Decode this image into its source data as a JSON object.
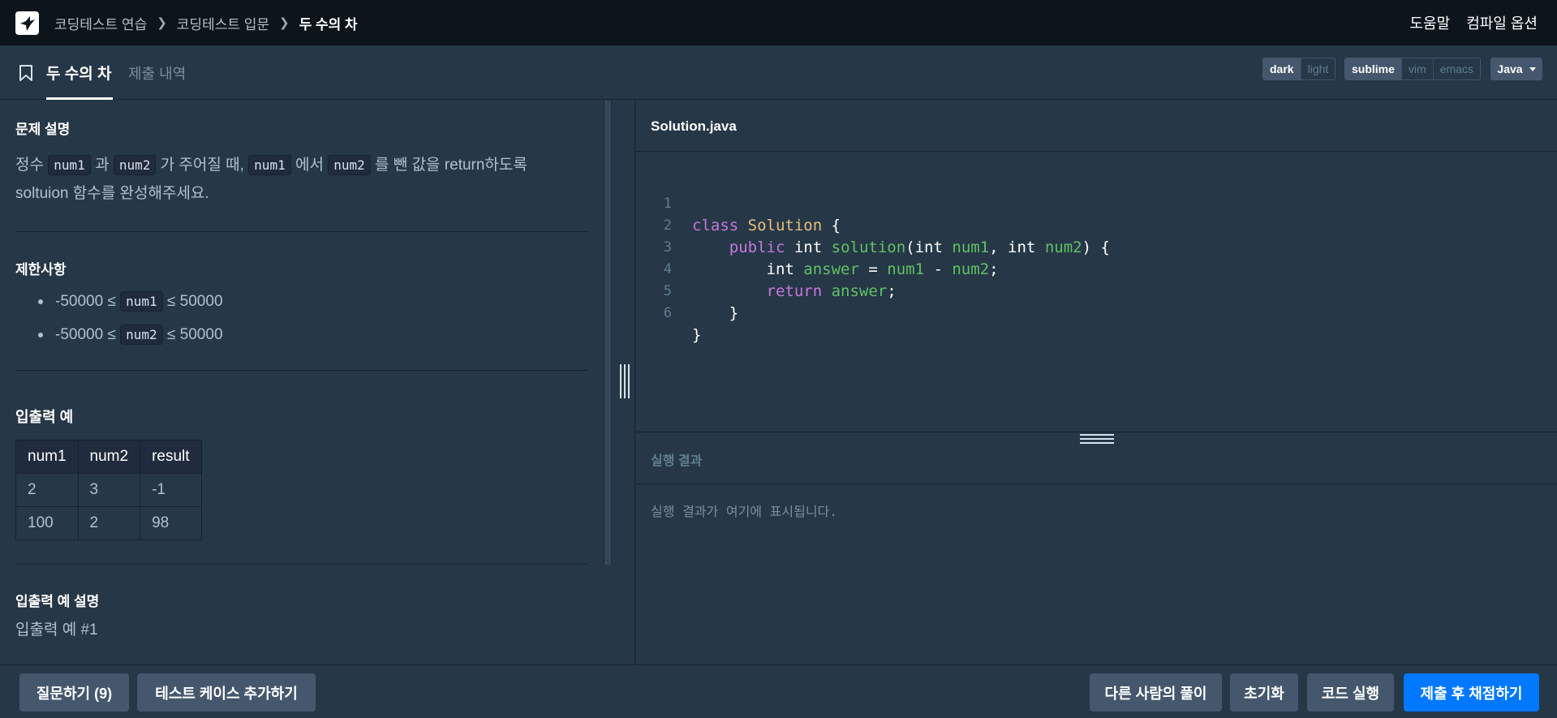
{
  "nav": {
    "breadcrumb": [
      "코딩테스트 연습",
      "코딩테스트 입문",
      "두 수의 차"
    ],
    "help": "도움말",
    "compile_options": "컴파일 옵션"
  },
  "tabs": {
    "active": "두 수의 차",
    "submissions": "제출 내역"
  },
  "toolbar": {
    "themes": [
      "dark",
      "light"
    ],
    "theme_selected": "dark",
    "keymaps": [
      "sublime",
      "vim",
      "emacs"
    ],
    "keymap_selected": "sublime",
    "language": "Java"
  },
  "problem": {
    "desc_title": "문제 설명",
    "desc": {
      "p1": "정수",
      "c1": "num1",
      "p2": "과",
      "c2": "num2",
      "p3": "가 주어질 때,",
      "c3": "num1",
      "p4": "에서",
      "c4": "num2",
      "p5": "를 뺀 값을 return하도록",
      "line2": "soltuion 함수를 완성해주세요."
    },
    "limits_title": "제한사항",
    "limits": [
      {
        "pre": "-50000 ≤",
        "code": "num1",
        "post": "≤ 50000"
      },
      {
        "pre": "-50000 ≤",
        "code": "num2",
        "post": "≤ 50000"
      }
    ],
    "io_title": "입출력 예",
    "io_table": {
      "headers": [
        "num1",
        "num2",
        "result"
      ],
      "rows": [
        [
          "2",
          "3",
          "-1"
        ],
        [
          "100",
          "2",
          "98"
        ]
      ]
    },
    "io_desc_title": "입출력 예 설명",
    "io_desc_item": "입출력 예 #1"
  },
  "editor": {
    "filename": "Solution.java",
    "line_numbers": [
      "1",
      "2",
      "3",
      "4",
      "5",
      "6"
    ],
    "tokens": {
      "class_kw": "class",
      "class_name": "Solution",
      "brace_open": " {",
      "public_kw": "public",
      "int_kw": "int",
      "method": "solution",
      "var_num1": "num1",
      "var_num2": "num2",
      "var_answer": "answer",
      "return_kw": "return"
    },
    "code_lines": [
      "class Solution {",
      "    public int solution(int num1, int num2) {",
      "        int answer = num1 - num2;",
      "        return answer;",
      "    }",
      "}"
    ]
  },
  "result": {
    "title": "실행 결과",
    "placeholder": "실행 결과가 여기에 표시됩니다."
  },
  "footer": {
    "question": "질문하기 (9)",
    "add_testcase": "테스트 케이스 추가하기",
    "others_solutions": "다른 사람의 풀이",
    "reset": "초기화",
    "run": "코드 실행",
    "submit": "제출 후 채점하기"
  },
  "colors": {
    "primary": "#0078ff",
    "bg": "#263747",
    "nav_bg": "#0c151c"
  }
}
